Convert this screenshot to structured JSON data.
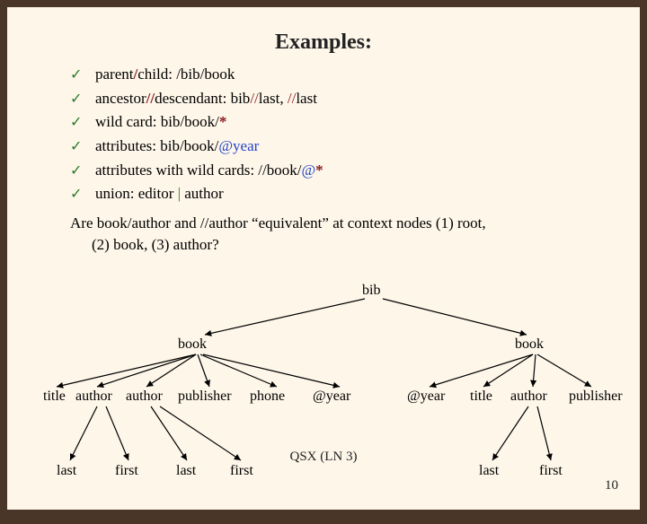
{
  "title": "Examples:",
  "bullets": [
    {
      "pre": "parent",
      "sep1": "/",
      "mid": "child:   ",
      "path": "/bib/book"
    },
    {
      "pre": "ancestor",
      "sep1": "//",
      "mid": "descendant:   bib",
      "sep2": "//",
      "tail": "last,  ",
      "sep3": "//",
      "tail2": "last"
    },
    {
      "text1": "wild card:        bib/book/",
      "red": "*"
    },
    {
      "text1": "attributes:       bib/book/",
      "blue": "@year"
    },
    {
      "text1": "attributes with wild cards:  //book/",
      "blue": "@",
      "red": "*"
    },
    {
      "text1": "union: editor ",
      "green": "|",
      "text2": " author"
    }
  ],
  "question_l1": "Are book/author and //author “equivalent” at context nodes (1) root,",
  "question_l2": "(2) book, (3) author?",
  "tree": {
    "root": "bib",
    "left": {
      "label": "book",
      "children": [
        "title",
        "author",
        "author",
        "publisher",
        "phone",
        "@year"
      ],
      "leaves": [
        "last",
        "first",
        "last",
        "first"
      ]
    },
    "right": {
      "label": "book",
      "children": [
        "@year",
        "title",
        "author",
        "publisher"
      ],
      "leaves": [
        "last",
        "first"
      ]
    }
  },
  "footer": "QSX (LN 3)",
  "slidenum": "10"
}
